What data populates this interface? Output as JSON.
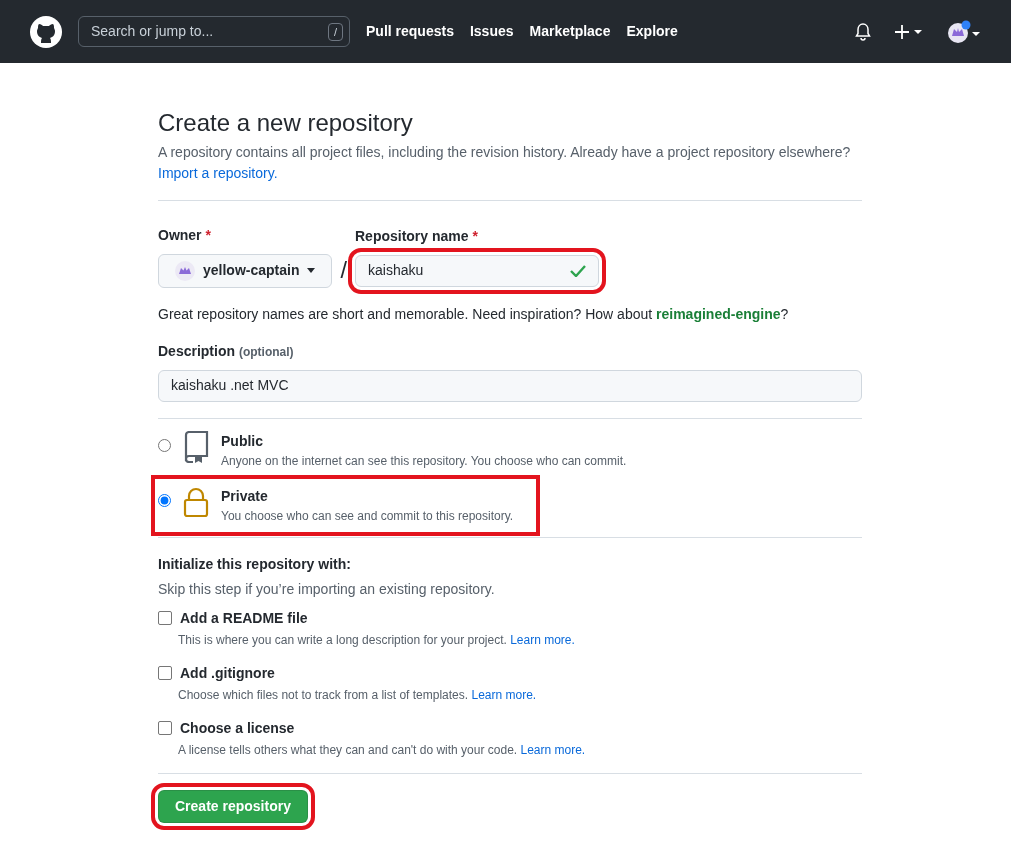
{
  "navbar": {
    "search": {
      "placeholder": "Search or jump to...",
      "shortcut": "/"
    },
    "links": [
      "Pull requests",
      "Issues",
      "Marketplace",
      "Explore"
    ],
    "notification_dot": true
  },
  "heading": "Create a new repository",
  "intro": {
    "text": "A repository contains all project files, including the revision history. Already have a project repository elsewhere?",
    "link": "Import a repository."
  },
  "owner": {
    "label": "Owner",
    "required_mark": "*",
    "value": "yellow-captain"
  },
  "separator": "/",
  "repo_name": {
    "label": "Repository name",
    "required_mark": "*",
    "value": "kaishaku",
    "valid": true,
    "highlighted": true
  },
  "name_hint": {
    "text": "Great repository names are short and memorable. Need inspiration? How about",
    "link": "reimagined-engine",
    "end": "?"
  },
  "description": {
    "label": "Description",
    "note": "(optional)",
    "value": "kaishaku .net MVC"
  },
  "visibility": [
    {
      "kind": "public",
      "title": "Public",
      "text": "Anyone on the internet can see this repository. You choose who can commit.",
      "selected": false
    },
    {
      "kind": "private",
      "title": "Private",
      "text": "You choose who can see and commit to this repository.",
      "selected": true,
      "highlighted": true
    }
  ],
  "init": {
    "title": "Initialize this repository with:",
    "hint": "Skip this step if you’re importing an existing repository.",
    "options": [
      {
        "label": "Add a README file",
        "text": "This is where you can write a long description for your project.",
        "link": "Learn more.",
        "checked": false
      },
      {
        "label": "Add .gitignore",
        "text": "Choose which files not to track from a list of templates.",
        "link": "Learn more.",
        "checked": false
      },
      {
        "label": "Choose a license",
        "text": "A license tells others what they can and can't do with your code.",
        "link": "Learn more.",
        "checked": false
      }
    ]
  },
  "create_button": {
    "label": "Create repository",
    "highlighted": true
  }
}
